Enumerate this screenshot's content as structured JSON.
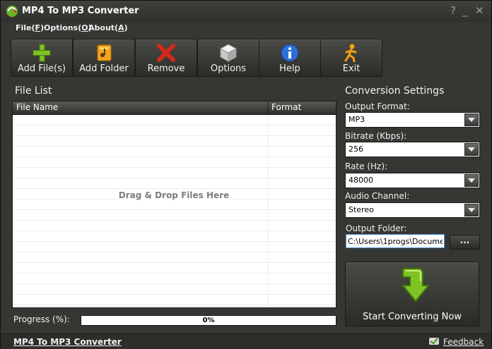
{
  "window": {
    "title": "MP4 To MP3 Converter",
    "help_glyph": "?",
    "min_glyph": "_",
    "close_glyph": "✕"
  },
  "menu": {
    "items": [
      {
        "label": "File(",
        "key": "F",
        "end": ")"
      },
      {
        "label": "Options(",
        "key": "O",
        "end": ")"
      },
      {
        "label": "About(",
        "key": "A",
        "end": ")"
      }
    ]
  },
  "toolbar": {
    "buttons": [
      {
        "label": "Add File(s)",
        "icon": "plus-icon"
      },
      {
        "label": "Add Folder",
        "icon": "folder-icon"
      },
      {
        "label": "Remove",
        "icon": "remove-x-icon"
      },
      {
        "label": "Options",
        "icon": "cube-icon"
      },
      {
        "label": "Help",
        "icon": "info-icon"
      },
      {
        "label": "Exit",
        "icon": "runner-icon"
      }
    ]
  },
  "file_list": {
    "title": "File List",
    "columns": [
      "File Name",
      "Format"
    ],
    "drop_hint": "Drag & Drop Files Here"
  },
  "progress": {
    "label": "Progress (%):",
    "value_text": "0%",
    "value": 0
  },
  "settings": {
    "title": "Conversion Settings",
    "output_format": {
      "label": "Output Format:",
      "value": "MP3"
    },
    "bitrate": {
      "label": "Bitrate (Kbps):",
      "value": "256"
    },
    "rate": {
      "label": "Rate (Hz):",
      "value": "48000"
    },
    "channel": {
      "label": "Audio Channel:",
      "value": "Stereo"
    },
    "output_folder": {
      "label": "Output Folder:",
      "value": "C:\\Users\\1progs\\Docume",
      "browse_label": "..."
    },
    "start_label": "Start Converting Now"
  },
  "status": {
    "app_link": "MP4 To MP3 Converter",
    "feedback": "Feedback"
  },
  "colors": {
    "background": "#363733",
    "accent_green": "#7ec224",
    "remove_red": "#d42a1a",
    "help_blue": "#2f6fd8",
    "exit_orange": "#f0a010"
  }
}
